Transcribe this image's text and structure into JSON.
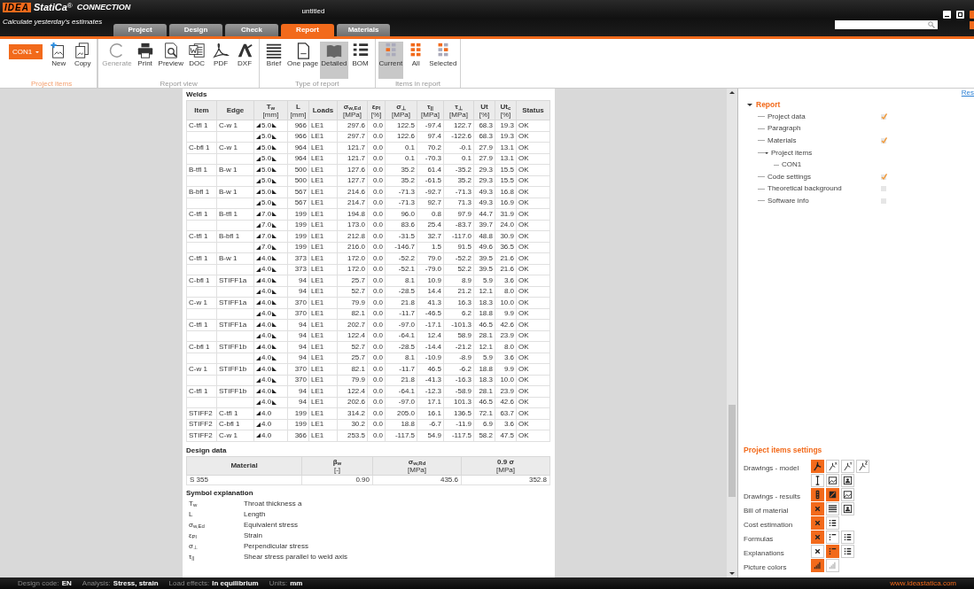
{
  "app": {
    "logo": "IDEA",
    "brand": "StatiCa",
    "reg": "®",
    "product": "CONNECTION",
    "tagline": "Calculate yesterday's estimates"
  },
  "window": {
    "title": "untitled"
  },
  "tabs": [
    {
      "label": "Project",
      "selected": false
    },
    {
      "label": "Design",
      "selected": false
    },
    {
      "label": "Check",
      "selected": false
    },
    {
      "label": "Report",
      "selected": true
    },
    {
      "label": "Materials",
      "selected": false
    }
  ],
  "ribbon": {
    "item_dropdown": "CON1",
    "groups": [
      {
        "label": "Project items",
        "highlighted": true,
        "buttons": [
          {
            "label": "New",
            "kind": "new",
            "disabled": false,
            "selected": false
          },
          {
            "label": "Copy",
            "kind": "copy",
            "disabled": false,
            "selected": false
          }
        ]
      },
      {
        "label": "Report view",
        "highlighted": false,
        "buttons": [
          {
            "label": "Generate",
            "kind": "generate",
            "disabled": true,
            "selected": false
          },
          {
            "label": "Print",
            "kind": "print",
            "disabled": false,
            "selected": false
          },
          {
            "label": "Preview",
            "kind": "preview",
            "disabled": false,
            "selected": false
          },
          {
            "label": "DOC",
            "kind": "doc",
            "disabled": false,
            "selected": false
          },
          {
            "label": "PDF",
            "kind": "pdf",
            "disabled": false,
            "selected": false
          },
          {
            "label": "DXF",
            "kind": "dxf",
            "disabled": false,
            "selected": false
          }
        ]
      },
      {
        "label": "Type of report",
        "highlighted": false,
        "buttons": [
          {
            "label": "Brief",
            "kind": "brief",
            "disabled": false,
            "selected": false
          },
          {
            "label": "One page",
            "kind": "onepage",
            "disabled": false,
            "selected": false
          },
          {
            "label": "Detailed",
            "kind": "detailed",
            "disabled": false,
            "selected": true
          },
          {
            "label": "BOM",
            "kind": "bom",
            "disabled": false,
            "selected": false
          }
        ]
      },
      {
        "label": "Items in report",
        "highlighted": false,
        "buttons": [
          {
            "label": "Current",
            "kind": "current",
            "disabled": false,
            "selected": true
          },
          {
            "label": "All",
            "kind": "all",
            "disabled": false,
            "selected": false
          },
          {
            "label": "Selected",
            "kind": "selected",
            "disabled": false,
            "selected": false
          }
        ]
      }
    ]
  },
  "report": {
    "welds": {
      "title": "Welds",
      "columns": [
        {
          "label": "Item"
        },
        {
          "label": "Edge"
        },
        {
          "label": "T$_{w}$",
          "unit": "[mm]"
        },
        {
          "label": "L",
          "unit": "[mm]"
        },
        {
          "label": "Loads"
        },
        {
          "label": "σ$_{w,Ed}$",
          "unit": "[MPa]"
        },
        {
          "label": "ε$_{Pl}$",
          "unit": "[%]"
        },
        {
          "label": "σ$_{⊥}$",
          "unit": "[MPa]"
        },
        {
          "label": "τ$_{||}$",
          "unit": "[MPa]"
        },
        {
          "label": "τ$_{⊥}$",
          "unit": "[MPa]"
        },
        {
          "label": "Ut",
          "unit": "[%]"
        },
        {
          "label": "Ut$_{c}$",
          "unit": "[%]"
        },
        {
          "label": "Status"
        }
      ],
      "rows": [
        {
          "end_mark": true,
          "cells": [
            "C-tfl 1",
            "C-w 1",
            "5.0",
            "966",
            "LE1",
            "297.6",
            "0.0",
            "122.5",
            "-97.4",
            "122.7",
            "68.3",
            "19.3",
            "OK"
          ]
        },
        {
          "end_mark": true,
          "cells": [
            "",
            "",
            "5.0",
            "966",
            "LE1",
            "297.7",
            "0.0",
            "122.6",
            "97.4",
            "-122.6",
            "68.3",
            "19.3",
            "OK"
          ]
        },
        {
          "end_mark": true,
          "cells": [
            "C-bfl 1",
            "C-w 1",
            "5.0",
            "964",
            "LE1",
            "121.7",
            "0.0",
            "0.1",
            "70.2",
            "-0.1",
            "27.9",
            "13.1",
            "OK"
          ]
        },
        {
          "end_mark": true,
          "cells": [
            "",
            "",
            "5.0",
            "964",
            "LE1",
            "121.7",
            "0.0",
            "0.1",
            "-70.3",
            "0.1",
            "27.9",
            "13.1",
            "OK"
          ]
        },
        {
          "end_mark": true,
          "cells": [
            "B-tfl 1",
            "B-w 1",
            "5.0",
            "500",
            "LE1",
            "127.6",
            "0.0",
            "35.2",
            "61.4",
            "-35.2",
            "29.3",
            "15.5",
            "OK"
          ]
        },
        {
          "end_mark": true,
          "cells": [
            "",
            "",
            "5.0",
            "500",
            "LE1",
            "127.7",
            "0.0",
            "35.2",
            "-61.5",
            "35.2",
            "29.3",
            "15.5",
            "OK"
          ]
        },
        {
          "end_mark": true,
          "cells": [
            "B-bfl 1",
            "B-w 1",
            "5.0",
            "567",
            "LE1",
            "214.6",
            "0.0",
            "-71.3",
            "-92.7",
            "-71.3",
            "49.3",
            "16.8",
            "OK"
          ]
        },
        {
          "end_mark": true,
          "cells": [
            "",
            "",
            "5.0",
            "567",
            "LE1",
            "214.7",
            "0.0",
            "-71.3",
            "92.7",
            "71.3",
            "49.3",
            "16.9",
            "OK"
          ]
        },
        {
          "end_mark": true,
          "cells": [
            "C-tfl 1",
            "B-tfl 1",
            "7.0",
            "199",
            "LE1",
            "194.8",
            "0.0",
            "96.0",
            "0.8",
            "97.9",
            "44.7",
            "31.9",
            "OK"
          ]
        },
        {
          "end_mark": true,
          "cells": [
            "",
            "",
            "7.0",
            "199",
            "LE1",
            "173.0",
            "0.0",
            "83.6",
            "25.4",
            "-83.7",
            "39.7",
            "24.0",
            "OK"
          ]
        },
        {
          "end_mark": true,
          "cells": [
            "C-tfl 1",
            "B-bfl 1",
            "7.0",
            "199",
            "LE1",
            "212.8",
            "0.0",
            "-31.5",
            "32.7",
            "-117.0",
            "48.8",
            "30.9",
            "OK"
          ]
        },
        {
          "end_mark": true,
          "cells": [
            "",
            "",
            "7.0",
            "199",
            "LE1",
            "216.0",
            "0.0",
            "-146.7",
            "1.5",
            "91.5",
            "49.6",
            "36.5",
            "OK"
          ]
        },
        {
          "end_mark": true,
          "cells": [
            "C-tfl 1",
            "B-w 1",
            "4.0",
            "373",
            "LE1",
            "172.0",
            "0.0",
            "-52.2",
            "79.0",
            "-52.2",
            "39.5",
            "21.6",
            "OK"
          ]
        },
        {
          "end_mark": true,
          "cells": [
            "",
            "",
            "4.0",
            "373",
            "LE1",
            "172.0",
            "0.0",
            "-52.1",
            "-79.0",
            "52.2",
            "39.5",
            "21.6",
            "OK"
          ]
        },
        {
          "end_mark": true,
          "cells": [
            "C-bfl 1",
            "STIFF1a",
            "4.0",
            "94",
            "LE1",
            "25.7",
            "0.0",
            "8.1",
            "10.9",
            "8.9",
            "5.9",
            "3.6",
            "OK"
          ]
        },
        {
          "end_mark": true,
          "cells": [
            "",
            "",
            "4.0",
            "94",
            "LE1",
            "52.7",
            "0.0",
            "-28.5",
            "14.4",
            "21.2",
            "12.1",
            "8.0",
            "OK"
          ]
        },
        {
          "end_mark": true,
          "cells": [
            "C-w 1",
            "STIFF1a",
            "4.0",
            "370",
            "LE1",
            "79.9",
            "0.0",
            "21.8",
            "41.3",
            "16.3",
            "18.3",
            "10.0",
            "OK"
          ]
        },
        {
          "end_mark": true,
          "cells": [
            "",
            "",
            "4.0",
            "370",
            "LE1",
            "82.1",
            "0.0",
            "-11.7",
            "-46.5",
            "6.2",
            "18.8",
            "9.9",
            "OK"
          ]
        },
        {
          "end_mark": true,
          "cells": [
            "C-tfl 1",
            "STIFF1a",
            "4.0",
            "94",
            "LE1",
            "202.7",
            "0.0",
            "-97.0",
            "-17.1",
            "-101.3",
            "46.5",
            "42.6",
            "OK"
          ]
        },
        {
          "end_mark": true,
          "cells": [
            "",
            "",
            "4.0",
            "94",
            "LE1",
            "122.4",
            "0.0",
            "-64.1",
            "12.4",
            "58.9",
            "28.1",
            "23.9",
            "OK"
          ]
        },
        {
          "end_mark": true,
          "cells": [
            "C-bfl 1",
            "STIFF1b",
            "4.0",
            "94",
            "LE1",
            "52.7",
            "0.0",
            "-28.5",
            "-14.4",
            "-21.2",
            "12.1",
            "8.0",
            "OK"
          ]
        },
        {
          "end_mark": true,
          "cells": [
            "",
            "",
            "4.0",
            "94",
            "LE1",
            "25.7",
            "0.0",
            "8.1",
            "-10.9",
            "-8.9",
            "5.9",
            "3.6",
            "OK"
          ]
        },
        {
          "end_mark": true,
          "cells": [
            "C-w 1",
            "STIFF1b",
            "4.0",
            "370",
            "LE1",
            "82.1",
            "0.0",
            "-11.7",
            "46.5",
            "-6.2",
            "18.8",
            "9.9",
            "OK"
          ]
        },
        {
          "end_mark": true,
          "cells": [
            "",
            "",
            "4.0",
            "370",
            "LE1",
            "79.9",
            "0.0",
            "21.8",
            "-41.3",
            "-16.3",
            "18.3",
            "10.0",
            "OK"
          ]
        },
        {
          "end_mark": true,
          "cells": [
            "C-tfl 1",
            "STIFF1b",
            "4.0",
            "94",
            "LE1",
            "122.4",
            "0.0",
            "-64.1",
            "-12.3",
            "-58.9",
            "28.1",
            "23.9",
            "OK"
          ]
        },
        {
          "end_mark": true,
          "cells": [
            "",
            "",
            "4.0",
            "94",
            "LE1",
            "202.6",
            "0.0",
            "-97.0",
            "17.1",
            "101.3",
            "46.5",
            "42.6",
            "OK"
          ]
        },
        {
          "end_mark": false,
          "cells": [
            "STIFF2",
            "C-tfl 1",
            "4.0",
            "199",
            "LE1",
            "314.2",
            "0.0",
            "205.0",
            "16.1",
            "136.5",
            "72.1",
            "63.7",
            "OK"
          ]
        },
        {
          "end_mark": false,
          "cells": [
            "STIFF2",
            "C-bfl 1",
            "4.0",
            "199",
            "LE1",
            "30.2",
            "0.0",
            "18.8",
            "-6.7",
            "-11.9",
            "6.9",
            "3.6",
            "OK"
          ]
        },
        {
          "end_mark": false,
          "cells": [
            "STIFF2",
            "C-w 1",
            "4.0",
            "366",
            "LE1",
            "253.5",
            "0.0",
            "-117.5",
            "54.9",
            "-117.5",
            "58.2",
            "47.5",
            "OK"
          ]
        }
      ]
    },
    "design_data": {
      "title": "Design data",
      "columns": [
        {
          "label": "Material"
        },
        {
          "label": "β$_{w}$",
          "unit": "[-]"
        },
        {
          "label": "σ$_{w,Rd}$",
          "unit": "[MPa]"
        },
        {
          "label": "0.9 σ",
          "unit": "[MPa]"
        }
      ],
      "rows": [
        [
          "S 355",
          "0.90",
          "435.6",
          "352.8"
        ]
      ]
    },
    "symbols": {
      "title": "Symbol explanation",
      "items": [
        {
          "symbol": "T$_{w}$",
          "meaning": "Throat thickness a"
        },
        {
          "symbol": "L",
          "meaning": "Length"
        },
        {
          "symbol": "σ$_{w,Ed}$",
          "meaning": "Equivalent stress"
        },
        {
          "symbol": "ε$_{Pl}$",
          "meaning": "Strain"
        },
        {
          "symbol": "σ$_{⊥}$",
          "meaning": "Perpendicular stress"
        },
        {
          "symbol": "τ$_{||}$",
          "meaning": "Shear stress parallel to weld axis"
        }
      ]
    }
  },
  "panel": {
    "link": "Res",
    "tree": {
      "label": "Report",
      "expanded": true,
      "children": [
        {
          "label": "Project data",
          "kind": "check",
          "checked": true
        },
        {
          "label": "Paragraph",
          "kind": "plain"
        },
        {
          "label": "Materials",
          "kind": "check",
          "checked": true
        },
        {
          "label": "Project items",
          "kind": "plain",
          "expanded": true,
          "children": [
            {
              "label": "CON1",
              "kind": "plain"
            }
          ]
        },
        {
          "label": "Code settings",
          "kind": "check",
          "checked": true
        },
        {
          "label": "Theoretical background",
          "kind": "check",
          "checked": false
        },
        {
          "label": "Software info",
          "kind": "check",
          "checked": false
        }
      ]
    },
    "settings": {
      "title": "Project items settings",
      "rows": [
        {
          "label": "Drawings - model",
          "options": [
            {
              "kind": "axes",
              "selected": true
            },
            {
              "kind": "axis-x",
              "selected": false
            },
            {
              "kind": "axis-y",
              "selected": false
            },
            {
              "kind": "axis-z",
              "selected": false
            }
          ]
        },
        {
          "options": [
            {
              "kind": "beam",
              "selected": false
            },
            {
              "kind": "image",
              "selected": false
            },
            {
              "kind": "portrait",
              "selected": false
            }
          ]
        },
        {
          "label": "Drawings - results",
          "options": [
            {
              "kind": "signal",
              "selected": true
            },
            {
              "kind": "stress",
              "selected": true
            },
            {
              "kind": "image",
              "selected": false
            }
          ]
        },
        {
          "label": "Bill of material",
          "options": [
            {
              "kind": "cross",
              "selected": true
            },
            {
              "kind": "lines",
              "selected": false
            },
            {
              "kind": "portrait",
              "selected": false
            }
          ]
        },
        {
          "label": "Cost estimation",
          "options": [
            {
              "kind": "cross",
              "selected": true
            },
            {
              "kind": "list",
              "selected": false
            }
          ]
        },
        {
          "label": "Formulas",
          "options": [
            {
              "kind": "cross",
              "selected": true
            },
            {
              "kind": "short-list",
              "selected": false
            },
            {
              "kind": "list",
              "selected": false
            }
          ]
        },
        {
          "label": "Explanations",
          "options": [
            {
              "kind": "cross",
              "selected": false
            },
            {
              "kind": "short-list",
              "selected": true
            },
            {
              "kind": "list",
              "selected": false
            }
          ]
        },
        {
          "label": "Picture colors",
          "options": [
            {
              "kind": "bars",
              "selected": true
            },
            {
              "kind": "bars-grey",
              "selected": false
            }
          ]
        }
      ]
    }
  },
  "status_bar": {
    "items": [
      {
        "label": "Design code:",
        "value": "EN"
      },
      {
        "label": "Analysis:",
        "value": "Stress, strain"
      },
      {
        "label": "Load effects:",
        "value": "In equilibrium"
      },
      {
        "label": "Units:",
        "value": "mm"
      }
    ],
    "link": "www.ideastatica.com"
  }
}
